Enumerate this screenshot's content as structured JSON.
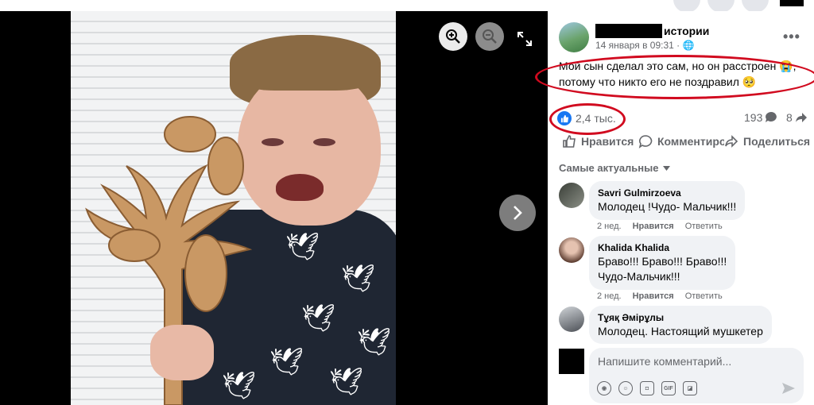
{
  "viewer": {
    "zoom_in": "zoom-in-icon",
    "zoom_out": "zoom-out-icon",
    "fullscreen": "expand-icon",
    "next": "chevron-right-icon"
  },
  "post": {
    "page_name": "истории",
    "date": "14 января в 09:31 · 🌐",
    "text": "Мой сын сделал это сам, но он расстроен 😭, потому что никто его не поздравил 🥺",
    "likes": "2,4 тыс.",
    "comments": "193",
    "shares": "8"
  },
  "actions": {
    "like": "Нравится",
    "comment": "Комментировать",
    "share": "Поделиться"
  },
  "comments_sort": "Самые актуальные",
  "comments": [
    {
      "author": "Savri Gulmirzoeva",
      "text": [
        "Молодец !Чудо- Мальчик!!!"
      ],
      "time": "2 нед.",
      "like": "Нравится",
      "reply": "Ответить"
    },
    {
      "author": "Khalida Khalida",
      "text": [
        "Браво!!! Браво!!! Браво!!!",
        "Чудо-Мальчик!!!"
      ],
      "time": "2 нед.",
      "like": "Нравится",
      "reply": "Ответить"
    },
    {
      "author": "Тұяқ Әмірұлы",
      "text": [
        "Молодец. Настоящий мушкетер"
      ],
      "time": "",
      "like": "",
      "reply": ""
    }
  ],
  "composer": {
    "placeholder": "Напишите комментарий..."
  },
  "colors": {
    "accent": "#1877f2",
    "annotation": "#d10a1f"
  }
}
